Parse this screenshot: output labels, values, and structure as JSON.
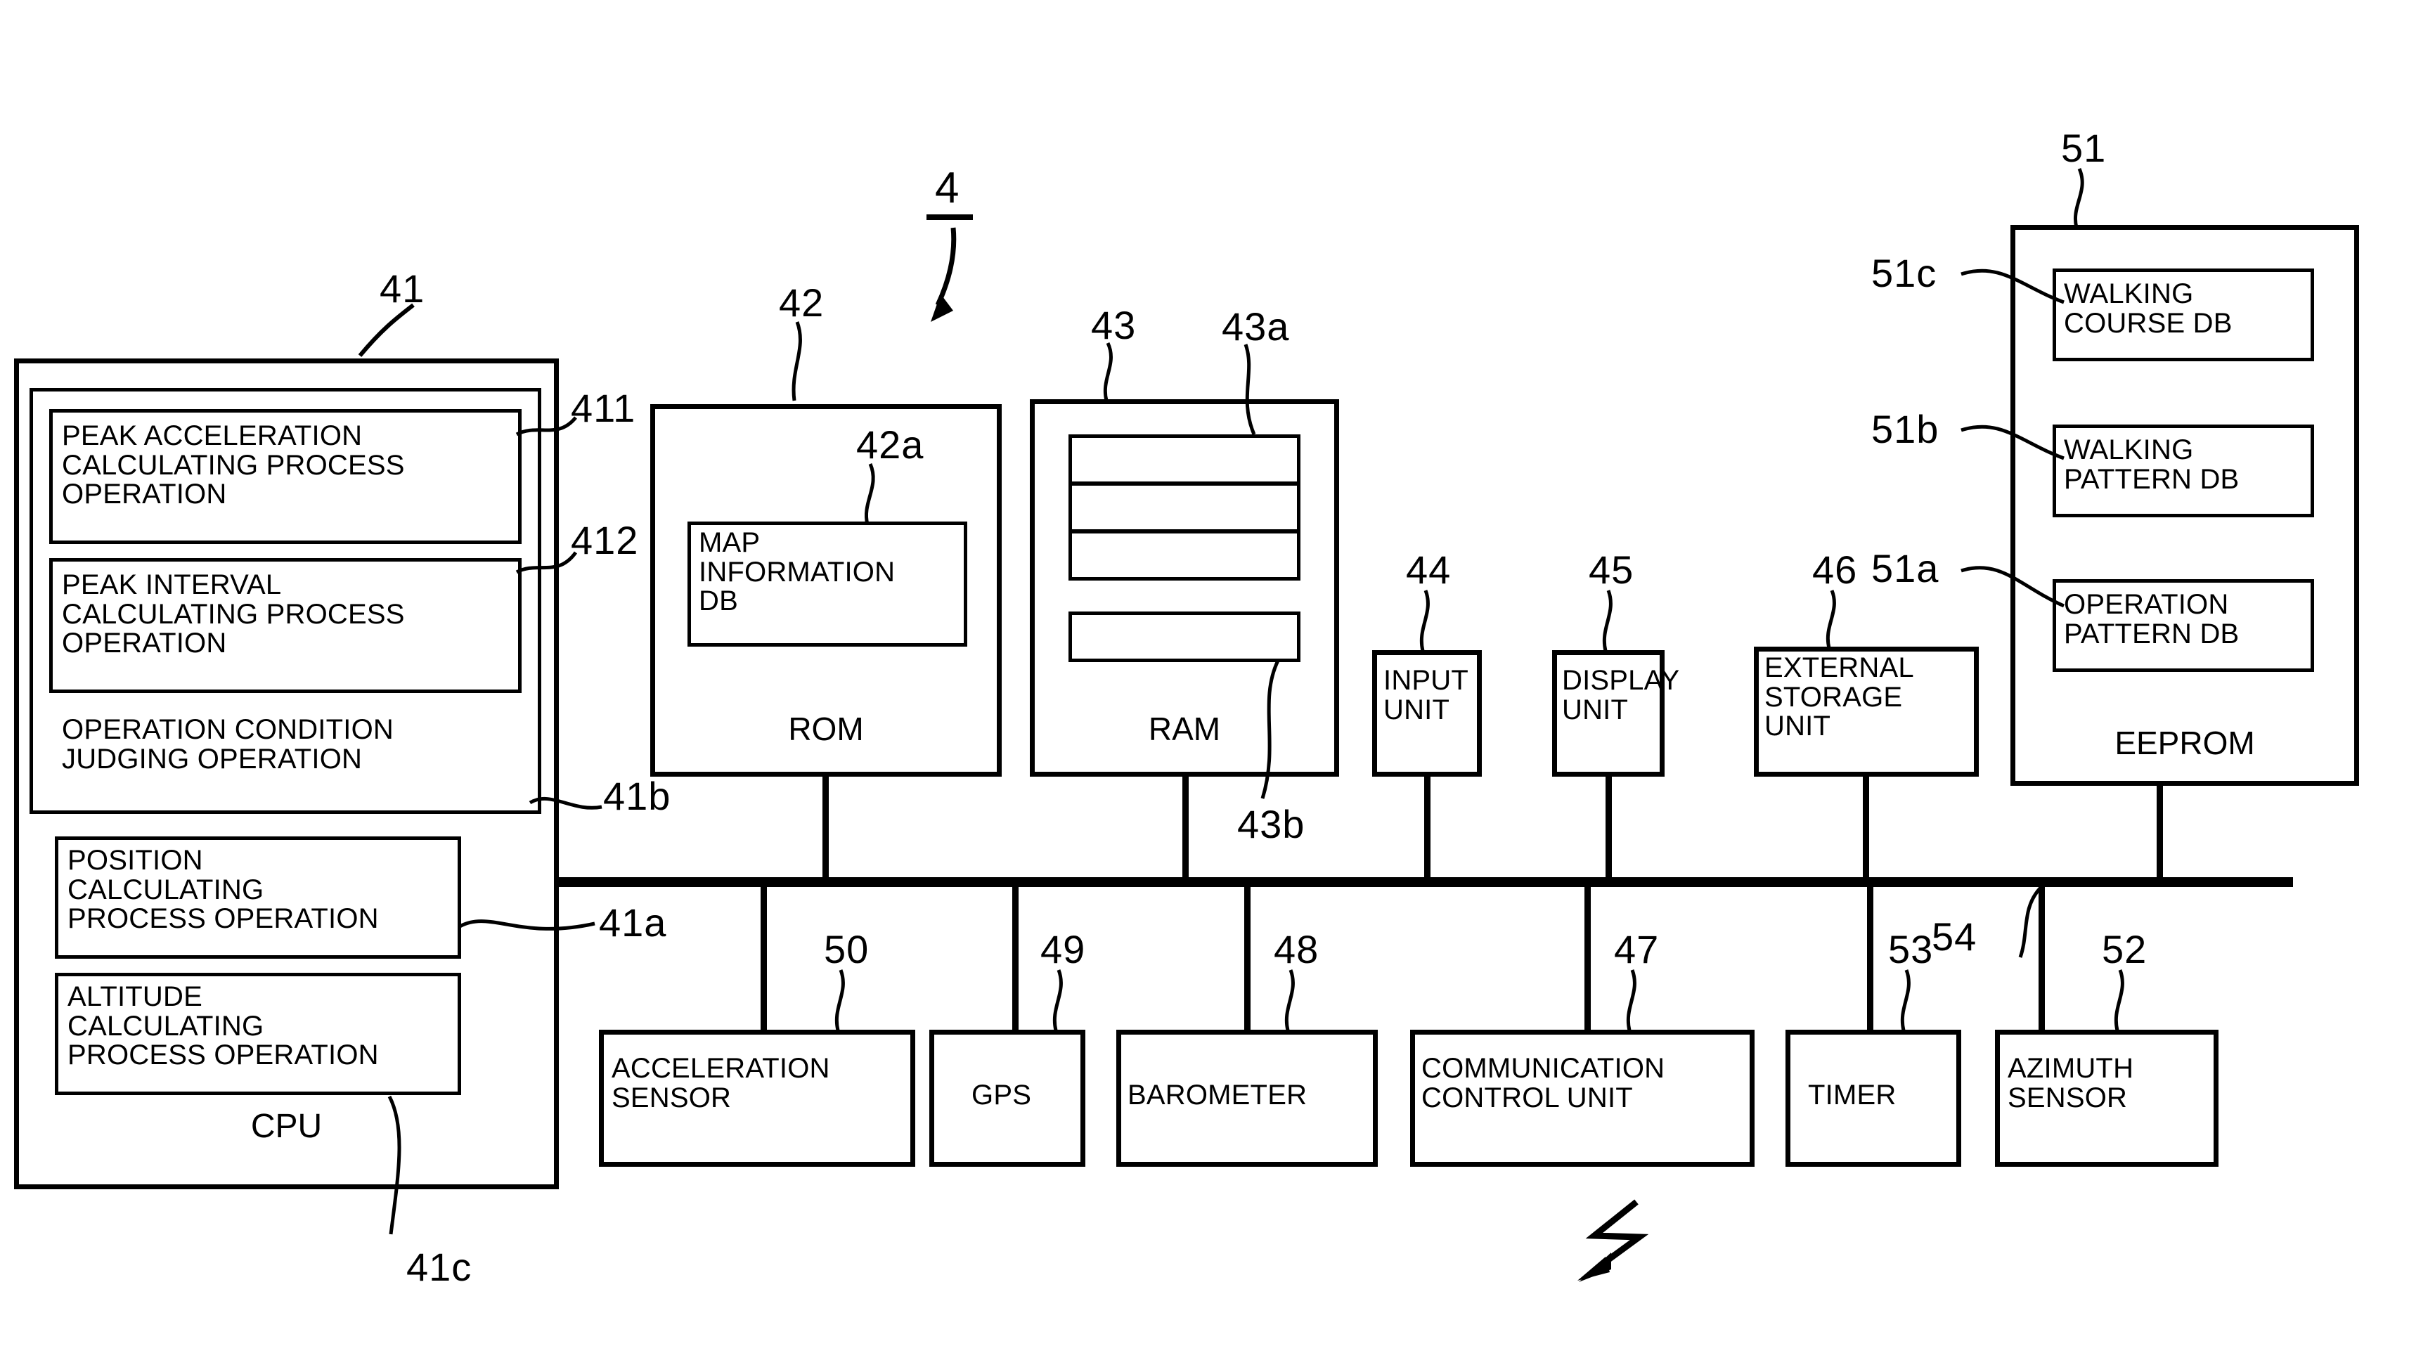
{
  "figure": {
    "reference_numeral": "4",
    "radio_symbol": "lightning-arrow"
  },
  "cpu": {
    "ref": "41",
    "title": "CPU",
    "inner_group": {
      "ref": "41b",
      "items": [
        {
          "ref": "411",
          "label": "PEAK ACCELERATION\nCALCULATING PROCESS\nOPERATION"
        },
        {
          "ref": "412",
          "label": "PEAK INTERVAL\nCALCULATING PROCESS\nOPERATION"
        },
        {
          "ref": "",
          "label": "OPERATION CONDITION\nJUDGING OPERATION"
        }
      ]
    },
    "position_block": {
      "ref": "41a",
      "label": "POSITION\nCALCULATING\nPROCESS OPERATION"
    },
    "altitude_block": {
      "ref": "41c",
      "label": "ALTITUDE\nCALCULATING\nPROCESS OPERATION"
    }
  },
  "rom": {
    "ref": "42",
    "title": "ROM",
    "db": {
      "ref": "42a",
      "label": "MAP\nINFORMATION\nDB"
    }
  },
  "ram": {
    "ref": "43",
    "title": "RAM",
    "stack_ref": "43a",
    "stack_rows": 3,
    "bottom_row_ref": "43b"
  },
  "peripherals_top": [
    {
      "ref": "44",
      "label": "INPUT\nUNIT"
    },
    {
      "ref": "45",
      "label": "DISPLAY\nUNIT"
    },
    {
      "ref": "46",
      "label": "EXTERNAL\nSTORAGE\nUNIT"
    }
  ],
  "eeprom": {
    "ref": "51",
    "title": "EEPROM",
    "dbs": [
      {
        "ref": "51c",
        "label": "WALKING\nCOURSE DB"
      },
      {
        "ref": "51b",
        "label": "WALKING\nPATTERN DB"
      },
      {
        "ref": "51a",
        "label": "OPERATION\nPATTERN DB"
      }
    ]
  },
  "peripherals_bottom": [
    {
      "ref": "50",
      "label": "ACCELERATION\nSENSOR"
    },
    {
      "ref": "49",
      "label": "GPS"
    },
    {
      "ref": "48",
      "label": "BAROMETER"
    },
    {
      "ref": "47",
      "label": "COMMUNICATION\nCONTROL UNIT"
    },
    {
      "ref": "53",
      "label": "TIMER"
    },
    {
      "ref": "52",
      "label": "AZIMUTH\nSENSOR"
    }
  ],
  "bus": {
    "ref": "54"
  }
}
